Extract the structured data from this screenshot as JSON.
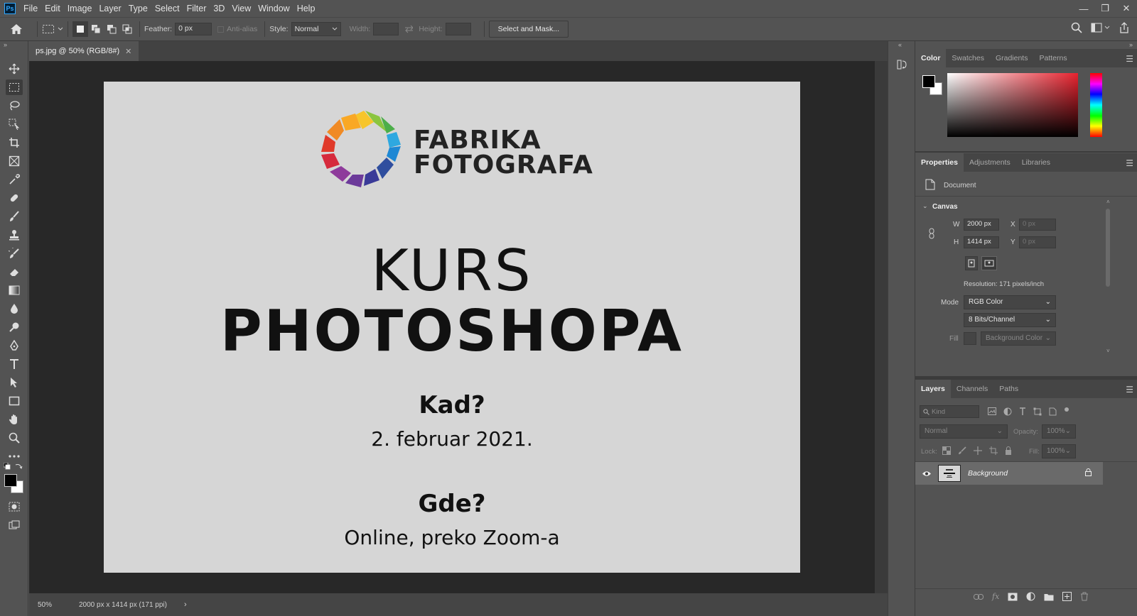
{
  "menubar": {
    "app_icon": "Ps",
    "items": [
      "File",
      "Edit",
      "Image",
      "Layer",
      "Type",
      "Select",
      "Filter",
      "3D",
      "View",
      "Window",
      "Help"
    ]
  },
  "options": {
    "feather_label": "Feather:",
    "feather_value": "0 px",
    "antialias_label": "Anti-alias",
    "style_label": "Style:",
    "style_value": "Normal",
    "width_label": "Width:",
    "height_label": "Height:",
    "select_mask_label": "Select and Mask..."
  },
  "document": {
    "tab_title": "ps.jpg @ 50% (RGB/8#)",
    "zoom": "50%",
    "info": "2000 px x 1414 px (171 ppi)"
  },
  "poster": {
    "brand_line1": "FABRIKA",
    "brand_line2": "FOTOGRAFA",
    "title_line1": "KURS",
    "title_line2": "PHOTOSHOPA",
    "when_label": "Kad?",
    "when_value": "2. februar 2021.",
    "where_label": "Gde?",
    "where_value": "Online, preko Zoom-a"
  },
  "color_panel": {
    "tabs": [
      "Color",
      "Swatches",
      "Gradients",
      "Patterns"
    ]
  },
  "properties_panel": {
    "tabs": [
      "Properties",
      "Adjustments",
      "Libraries"
    ],
    "doc_label": "Document",
    "canvas_label": "Canvas",
    "w_label": "W",
    "w_value": "2000 px",
    "h_label": "H",
    "h_value": "1414 px",
    "x_label": "X",
    "x_value": "0 px",
    "y_label": "Y",
    "y_value": "0 px",
    "resolution": "Resolution: 171 pixels/inch",
    "mode_label": "Mode",
    "mode_value": "RGB Color",
    "bits_value": "8 Bits/Channel",
    "fill_label": "Fill",
    "fill_value": "Background Color"
  },
  "layers_panel": {
    "tabs": [
      "Layers",
      "Channels",
      "Paths"
    ],
    "kind_placeholder": "Kind",
    "blend_mode": "Normal",
    "opacity_label": "Opacity:",
    "opacity_value": "100%",
    "lock_label": "Lock:",
    "fill_label": "Fill:",
    "fill_value": "100%",
    "layers": [
      {
        "name": "Background"
      }
    ]
  },
  "colors": {
    "accent": "#31a8ff",
    "panel_bg": "#535353",
    "canvas_bg": "#282828",
    "document_bg": "#d6d6d6"
  }
}
